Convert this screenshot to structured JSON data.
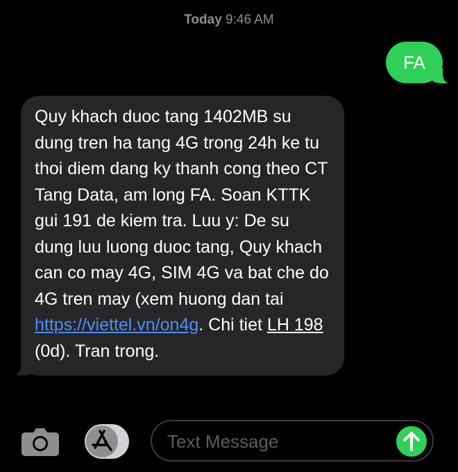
{
  "header": {
    "day": "Today",
    "time": "9:46 AM"
  },
  "messages": [
    {
      "direction": "outgoing",
      "text": "FA"
    },
    {
      "direction": "incoming",
      "text_before": "Quy khach duoc tang 1402MB su dung tren ha tang 4G trong 24h ke tu thoi diem dang ky thanh cong theo CT Tang Data, am long FA. Soan KTTK gui 191 de kiem tra. Luu y: De su dung luu luong duoc tang, Quy khach can co may 4G, SIM 4G va bat che do 4G tren may (xem huong dan tai ",
      "link": "https://viettel.vn/on4g",
      "text_middle": ". Chi tiet ",
      "phone_link": "LH 198",
      "text_after": " (0d). Tran trong."
    }
  ],
  "compose": {
    "placeholder": "Text Message"
  },
  "icons": {
    "camera": "camera-icon",
    "apps": "app-store-icon",
    "send": "arrow-up-icon"
  },
  "colors": {
    "background": "#000000",
    "outgoing_bubble": "#30d158",
    "incoming_bubble": "#262628",
    "link": "#4a8fff",
    "timestamp": "#8e8e93",
    "placeholder": "#5c5c60"
  }
}
